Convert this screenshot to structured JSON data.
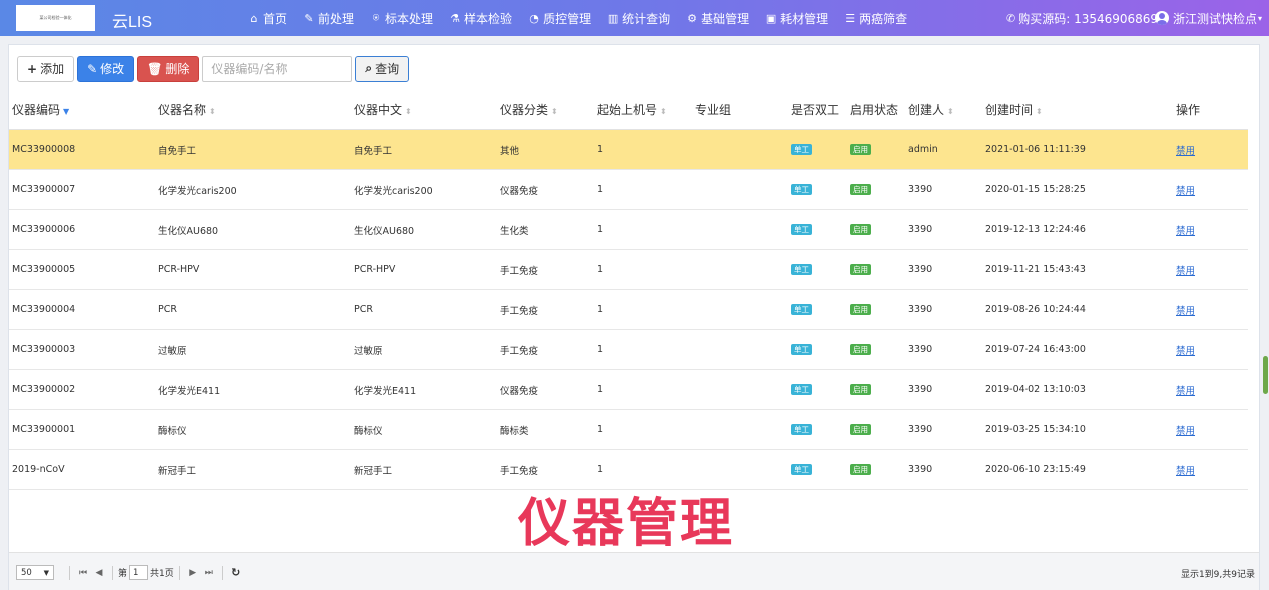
{
  "header": {
    "logo_text": "某公司检验一体化",
    "title": "云LIS",
    "nav": [
      {
        "icon": "home-icon",
        "glyph": "⌂",
        "label": "首页"
      },
      {
        "icon": "wrench-icon",
        "glyph": "✎",
        "label": "前处理"
      },
      {
        "icon": "tag-icon",
        "glyph": "⍟",
        "label": "标本处理"
      },
      {
        "icon": "flask-icon",
        "glyph": "⚗",
        "label": "样本检验"
      },
      {
        "icon": "pie-chart-icon",
        "glyph": "◔",
        "label": "质控管理"
      },
      {
        "icon": "bar-chart-icon",
        "glyph": "▥",
        "label": "统计查询"
      },
      {
        "icon": "gear-icon",
        "glyph": "⚙",
        "label": "基础管理"
      },
      {
        "icon": "briefcase-icon",
        "glyph": "▣",
        "label": "耗材管理"
      },
      {
        "icon": "list-icon",
        "glyph": "☰",
        "label": "两癌筛查"
      }
    ],
    "phone_label": "购买源码: 13546906869",
    "user_label": "浙江测试快检点"
  },
  "toolbar": {
    "add_label": "添加",
    "edit_label": "修改",
    "delete_label": "删除",
    "search_placeholder": "仪器编码/名称",
    "query_label": "查询"
  },
  "table": {
    "columns": [
      "仪器编码",
      "仪器名称",
      "仪器中文",
      "仪器分类",
      "起始上机号",
      "专业组",
      "是否双工",
      "启用状态",
      "创建人",
      "创建时间",
      "操作"
    ],
    "rows": [
      {
        "code": "MC33900008",
        "name": "自免手工",
        "cn": "自免手工",
        "category": "其他",
        "start": "1",
        "group": "",
        "duplex": "单工",
        "status": "启用",
        "creator": "admin",
        "time": "2021-01-06 11:11:39",
        "action": "禁用"
      },
      {
        "code": "MC33900007",
        "name": "化学发光caris200",
        "cn": "化学发光caris200",
        "category": "仪器免疫",
        "start": "1",
        "group": "",
        "duplex": "单工",
        "status": "启用",
        "creator": "3390",
        "time": "2020-01-15 15:28:25",
        "action": "禁用"
      },
      {
        "code": "MC33900006",
        "name": "生化仪AU680",
        "cn": "生化仪AU680",
        "category": "生化类",
        "start": "1",
        "group": "",
        "duplex": "单工",
        "status": "启用",
        "creator": "3390",
        "time": "2019-12-13 12:24:46",
        "action": "禁用"
      },
      {
        "code": "MC33900005",
        "name": "PCR-HPV",
        "cn": "PCR-HPV",
        "category": "手工免疫",
        "start": "1",
        "group": "",
        "duplex": "单工",
        "status": "启用",
        "creator": "3390",
        "time": "2019-11-21 15:43:43",
        "action": "禁用"
      },
      {
        "code": "MC33900004",
        "name": "PCR",
        "cn": "PCR",
        "category": "手工免疫",
        "start": "1",
        "group": "",
        "duplex": "单工",
        "status": "启用",
        "creator": "3390",
        "time": "2019-08-26 10:24:44",
        "action": "禁用"
      },
      {
        "code": "MC33900003",
        "name": "过敏原",
        "cn": "过敏原",
        "category": "手工免疫",
        "start": "1",
        "group": "",
        "duplex": "单工",
        "status": "启用",
        "creator": "3390",
        "time": "2019-07-24 16:43:00",
        "action": "禁用"
      },
      {
        "code": "MC33900002",
        "name": "化学发光E411",
        "cn": "化学发光E411",
        "category": "仪器免疫",
        "start": "1",
        "group": "",
        "duplex": "单工",
        "status": "启用",
        "creator": "3390",
        "time": "2019-04-02 13:10:03",
        "action": "禁用"
      },
      {
        "code": "MC33900001",
        "name": "酶标仪",
        "cn": "酶标仪",
        "category": "酶标类",
        "start": "1",
        "group": "",
        "duplex": "单工",
        "status": "启用",
        "creator": "3390",
        "time": "2019-03-25 15:34:10",
        "action": "禁用"
      },
      {
        "code": "2019-nCoV",
        "name": "新冠手工",
        "cn": "新冠手工",
        "category": "手工免疫",
        "start": "1",
        "group": "",
        "duplex": "单工",
        "status": "启用",
        "creator": "3390",
        "time": "2020-06-10 23:15:49",
        "action": "禁用"
      }
    ]
  },
  "watermark": "仪器管理",
  "pager": {
    "page_size": "50",
    "page_prefix": "第",
    "page_value": "1",
    "page_total": "共1页",
    "summary": "显示1到9,共9记录"
  },
  "colors": {
    "selected_row": "#fde58f",
    "watermark": "#e8385a",
    "header_gradient_start": "#5a88e6",
    "header_gradient_end": "#9b63e8"
  }
}
